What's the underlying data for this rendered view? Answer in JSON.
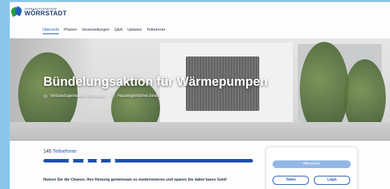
{
  "header": {
    "logo_small": "VERBANDSGEMEINDE",
    "logo_big": "WÖRRSTADT"
  },
  "nav": {
    "items": [
      {
        "label": "Übersicht",
        "active": true
      },
      {
        "label": "Phasen"
      },
      {
        "label": "Veranstaltungen"
      },
      {
        "label": "Q&A"
      },
      {
        "label": "Updates"
      },
      {
        "label": "Teilnehmer"
      }
    ]
  },
  "hero": {
    "title": "Bündelungsaktion für Wärmepumpen",
    "location": "Verbandsgemeinde Wörrstadt",
    "audience": "Hauseigentümer:innen"
  },
  "participants": {
    "count": "145",
    "label": "Teilnehmer",
    "progress_steps_total": 4,
    "progress_steps_done": 4
  },
  "cta_text": "Nutzen Sie die Chance, Ihre Heizung gemeinsam zu modernisieren und sparen Sie dabei bares Geld!",
  "card": {
    "join_label": "Mitmachen",
    "share_label": "Teilen",
    "login_label": "Login"
  },
  "icons": {
    "location": "location-pin-icon",
    "audience": "people-icon"
  },
  "colors": {
    "accent": "#1e56b3",
    "background": "#8cc7ea",
    "button_primary": "#93b8e6"
  }
}
